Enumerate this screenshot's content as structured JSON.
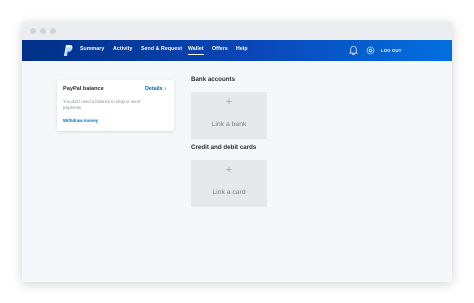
{
  "nav": {
    "items": [
      {
        "label": "Summary"
      },
      {
        "label": "Activity"
      },
      {
        "label": "Send & Request"
      },
      {
        "label": "Wallet"
      },
      {
        "label": "Offers"
      },
      {
        "label": "Help"
      }
    ],
    "active": "Wallet",
    "logout_label": "LOG OUT",
    "icons": [
      "paypal-logo",
      "bell-icon",
      "gear-icon"
    ]
  },
  "balance_card": {
    "title": "PayPal balance",
    "details_link": "Details",
    "details_chevron": "›",
    "description": "You don't need a balance to shop or send payments.",
    "withdraw_link": "Withdraw money"
  },
  "bank_accounts": {
    "heading": "Bank accounts",
    "tile_plus": "+",
    "tile_label": "Link a bank"
  },
  "cards": {
    "heading": "Credit and debit cards",
    "tile_plus": "+",
    "tile_label": "Link a card"
  },
  "colors": {
    "nav_start": "#003087",
    "nav_end": "#0070e0",
    "link": "#0070ba",
    "page_bg": "#f5f7fa"
  }
}
